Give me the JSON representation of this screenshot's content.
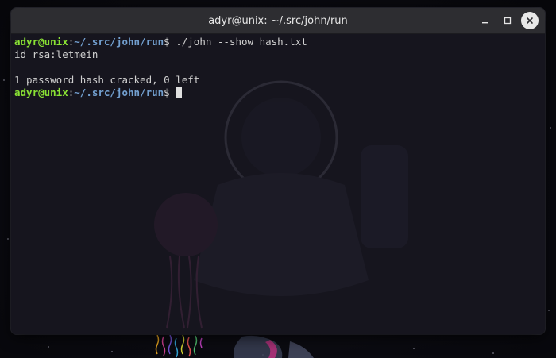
{
  "window": {
    "title": "adyr@unix: ~/.src/john/run"
  },
  "terminal": {
    "lines": [
      {
        "user": "adyr@unix",
        "sep": ":",
        "path": "~/.src/john/run",
        "prompt": "$ ",
        "command": "./john --show hash.txt"
      },
      {
        "text": "id_rsa:letmein"
      },
      {
        "text": ""
      },
      {
        "text": "1 password hash cracked, 0 left"
      },
      {
        "user": "adyr@unix",
        "sep": ":",
        "path": "~/.src/john/run",
        "prompt": "$ ",
        "command": ""
      }
    ]
  },
  "colors": {
    "user": "#8ae234",
    "path": "#729fcf",
    "text": "#d0d0d0",
    "titlebar": "#2d2d31",
    "terminal_bg": "#16151e"
  },
  "icons": {
    "minimize": "minimize-icon",
    "maximize": "maximize-icon",
    "close": "close-icon"
  }
}
